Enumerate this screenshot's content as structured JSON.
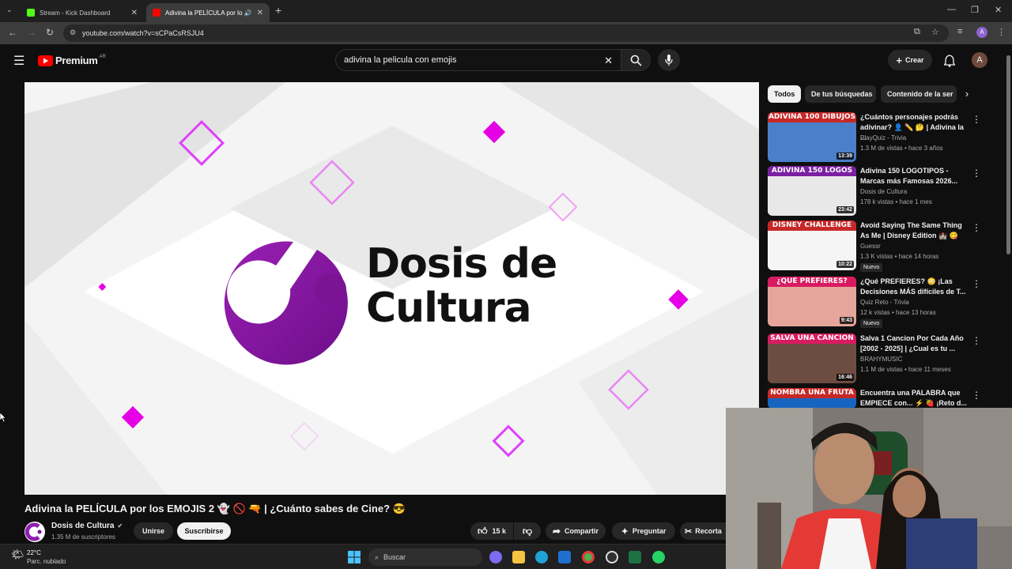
{
  "browser": {
    "tabs": [
      {
        "label": "Stream - Kick Dashboard",
        "favicon_color": "#53fc18",
        "active": false
      },
      {
        "label": "Adivina la PELÍCULA por los",
        "favicon_color": "#ff0000",
        "active": true
      }
    ],
    "url": "youtube.com/watch?v=sCPaCsRSJU4"
  },
  "youtube": {
    "logo_text": "Premium",
    "region": "AR",
    "search_value": "adivina la pelicula con emojis",
    "create_label": "Crear",
    "avatar_letter": "A"
  },
  "video": {
    "logo_line1": "Dosis de",
    "logo_line2": "Cultura",
    "title": "Adivina la PELÍCULA por los EMOJIS 2 👻 🚫 🔫 | ¿Cuánto sabes de Cine? 😎",
    "channel": "Dosis de Cultura",
    "subscribers": "1.35 M de suscriptores",
    "join_label": "Unirse",
    "subscribe_label": "Suscribirse",
    "likes": "15 k",
    "share_label": "Compartir",
    "ask_label": "Preguntar",
    "clip_label": "Recorta"
  },
  "chips": [
    "Todos",
    "De tus búsquedas",
    "Contenido de la ser"
  ],
  "recommendations": [
    {
      "title": "¿Cuántos personajes podrás adivinar? 👤 ✏️ 🤔 | Adivina la ...",
      "channel": "PlayQuiz - Trivia",
      "meta": "1.3 M de vistas • hace 3 años",
      "duration": "13:39",
      "banner": "ADIVINA 100 DIBUJOS",
      "banner_color": "#c62828",
      "thumb_color": "#4a7fc9",
      "new": ""
    },
    {
      "title": "Adivina 150 LOGOTIPOS - Marcas más Famosas 2026...",
      "channel": "Dosis de Cultura",
      "meta": "178 k vistas • hace 1 mes",
      "duration": "23:42",
      "banner": "ADIVINA 150 LOGOS",
      "banner_color": "#7b1fa2",
      "thumb_color": "#e8e8e8",
      "new": ""
    },
    {
      "title": "Avoid Saying The Same Thing As Me | Disney Edition 🏰 😋",
      "channel": "Guessr",
      "meta": "1.3 K vistas • hace 14 horas",
      "duration": "10:22",
      "banner": "DISNEY CHALLENGE",
      "banner_color": "#c62828",
      "thumb_color": "#f5f5f5",
      "new": "Nuevo"
    },
    {
      "title": "¿Qué PREFIERES? 😳 ¡Las Decisiones MÁS difíciles de T...",
      "channel": "Quiz Reto - Trivia",
      "meta": "12 k vistas • hace 13 horas",
      "duration": "9:43",
      "banner": "¿QUÉ PREFIERES?",
      "banner_color": "#d81b60",
      "thumb_color": "#e6a59a",
      "new": "Nuevo"
    },
    {
      "title": "Salva 1 Cancion Por Cada Año [2002 - 2025] | ¿Cual es tu ...",
      "channel": "BRAHYMUSIC",
      "meta": "1.1 M de vistas • hace 11 meses",
      "duration": "16:46",
      "banner": "SALVA UNA CANCION",
      "banner_color": "#d81b60",
      "thumb_color": "#6d4c41",
      "new": ""
    },
    {
      "title": "Encuentra una PALABRA que EMPIECE con... ⚡ 🍓 ¡Reto d...",
      "channel": "",
      "meta": "",
      "duration": "",
      "banner": "NOMBRA UNA FRUTA",
      "banner_color": "#c62828",
      "thumb_color": "#1565c0",
      "new": ""
    }
  ],
  "taskbar": {
    "temperature": "22°C",
    "weather": "Parc. nublado",
    "search_placeholder": "Buscar"
  }
}
